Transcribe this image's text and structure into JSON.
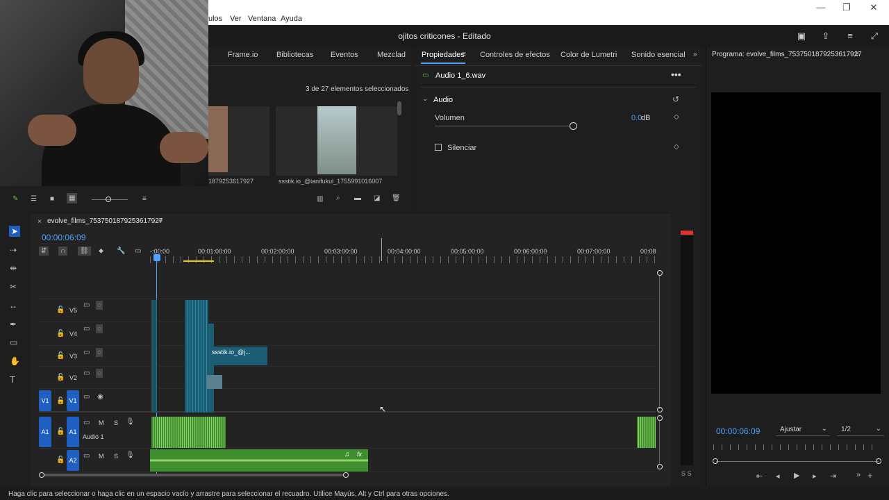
{
  "menubar": {
    "items": [
      "ulos",
      "Ver",
      "Ventana",
      "Ayuda"
    ]
  },
  "document": {
    "title": "ojitos criticones - Editado"
  },
  "project": {
    "tabs": [
      "Frame.io",
      "Bibliotecas",
      "Eventos",
      "Mezclad"
    ],
    "selection_text": "3 de 27 elementos seleccionados",
    "thumbs": [
      {
        "label": "1879253617927"
      },
      {
        "label": "ssstik.io_@ianifukul_1755991016007"
      }
    ]
  },
  "properties": {
    "tabs": [
      "Propiedades",
      "Controles de efectos",
      "Color de Lumetri",
      "Sonido esencial"
    ],
    "clip_name": "Audio 1_6.wav",
    "section": "Audio",
    "volume_label": "Volumen",
    "volume_value": "0.0",
    "volume_unit": "dB",
    "mute_label": "Silenciar"
  },
  "program": {
    "title": "Programa: evolve_films_7537501879253617927",
    "timecode": "00:00:06:09",
    "fit": "Ajustar",
    "resolution": "1/2"
  },
  "timeline": {
    "sequence_name": "evolve_films_7537501879253617927",
    "timecode": "00:00:06:09",
    "ruler": [
      "-:00:00",
      "00:01:00:00",
      "00:02:00:00",
      "00:03:00:00",
      "00:04:00:00",
      "00:05:00:00",
      "00:06:00:00",
      "00:07:00:00",
      "00:08"
    ],
    "video_tracks": [
      "V5",
      "V4",
      "V3",
      "V2",
      "V1"
    ],
    "audio_tracks": [
      "A1",
      "A2"
    ],
    "source_patch_v": "V1",
    "source_patch_a": "A1",
    "audio1_name": "Audio 1",
    "clip_v3_label": "ssstik.io_@j...",
    "mute": "M",
    "solo": "S"
  },
  "meter_labels": "S S",
  "status": "Haga clic para seleccionar o haga clic en un espacio vacío y arrastre para seleccionar el recuadro. Utilice Mayús, Alt y Ctrl para otras opciones.",
  "colors": {
    "accent": "#4da3ff",
    "video_clip": "#1b5e73",
    "audio_clip": "#3f8f2f",
    "track_button": "#1f5fbf"
  }
}
